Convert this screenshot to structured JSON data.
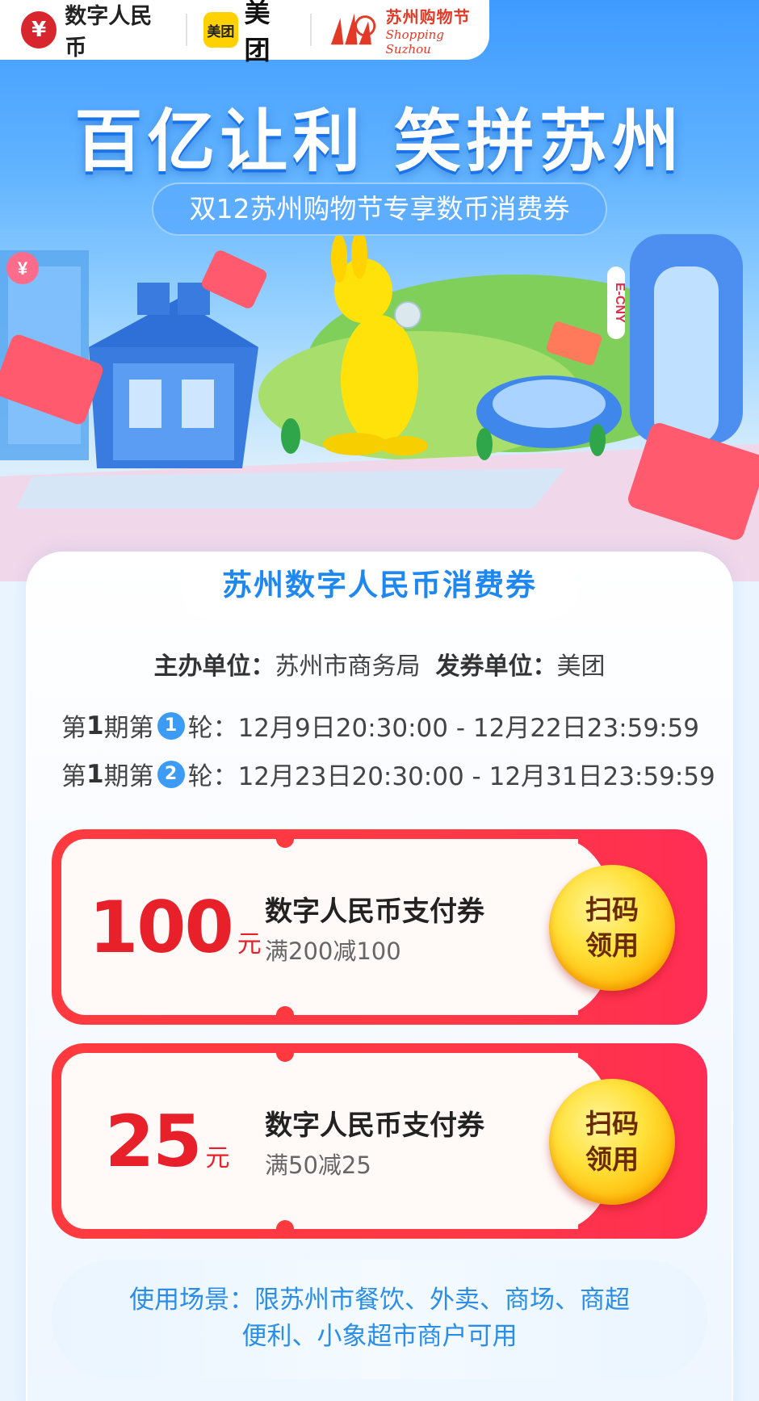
{
  "logos": {
    "ecny_mark": "¥",
    "ecny": "数字人民币",
    "meituan_mark": "美团",
    "meituan": "美团",
    "suzhou_cn": "苏州购物节",
    "suzhou_en": "Shopping Suzhou"
  },
  "hero": {
    "title": "百亿让利 笑拼苏州",
    "subtitle": "双12苏州购物节专享数币消费券",
    "badge": "¥",
    "tower_text": "E-CNY"
  },
  "card": {
    "tab_title": "苏州数字人民币消费券",
    "organizer_label": "主办单位：",
    "organizer": "苏州市商务局",
    "issuer_label": "发券单位：",
    "issuer": "美团",
    "rounds": [
      {
        "prefix": "第",
        "period": "1",
        "mid": "期第",
        "round": "1",
        "suffix": "轮：",
        "time": "12月9日20:30:00 - 12月22日23:59:59"
      },
      {
        "prefix": "第",
        "period": "1",
        "mid": "期第",
        "round": "2",
        "suffix": "轮：",
        "time": "12月23日20:30:00 - 12月31日23:59:59"
      }
    ]
  },
  "coupons": [
    {
      "value": "100",
      "unit": "元",
      "title": "数字人民币支付券",
      "condition": "满200减100",
      "btn_line1": "扫码",
      "btn_line2": "领用"
    },
    {
      "value": "25",
      "unit": "元",
      "title": "数字人民币支付券",
      "condition": "满50减25",
      "btn_line1": "扫码",
      "btn_line2": "领用"
    }
  ],
  "scenario": {
    "line1": "使用场景：限苏州市餐饮、外卖、商场、商超",
    "line2": "便利、小象超市商户可用"
  },
  "colors": {
    "brand_blue": "#1e88f0",
    "coupon_red": "#ff3a3f",
    "button_gold": "#ffd21f"
  }
}
